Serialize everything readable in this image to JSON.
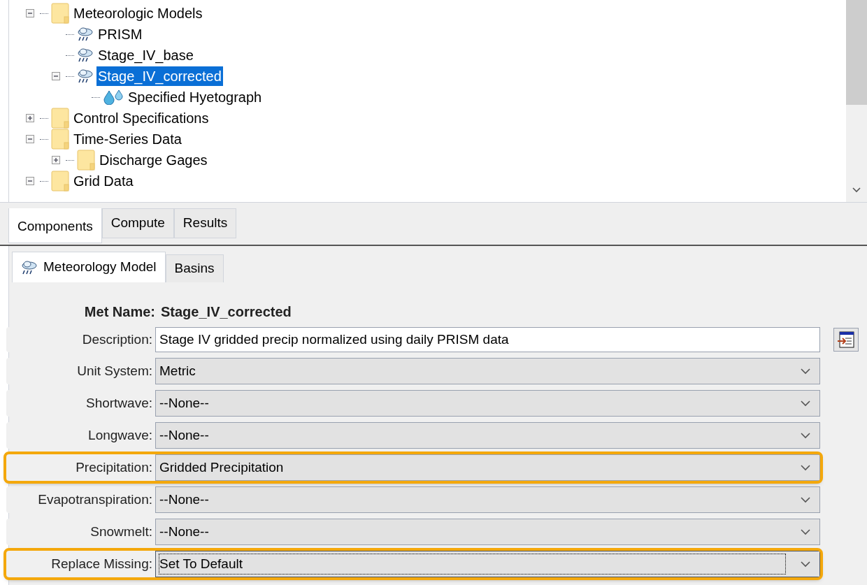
{
  "tree": [
    {
      "label": "Meteorologic Models",
      "kind": "folder",
      "expanded": true,
      "selected": false,
      "children": [
        {
          "label": "PRISM",
          "kind": "met",
          "selected": false
        },
        {
          "label": "Stage_IV_base",
          "kind": "met",
          "selected": false
        },
        {
          "label": "Stage_IV_corrected",
          "kind": "met",
          "expanded": true,
          "selected": true,
          "children": [
            {
              "label": "Specified Hyetograph",
              "kind": "gage",
              "selected": false
            }
          ]
        }
      ]
    },
    {
      "label": "Control Specifications",
      "kind": "folder",
      "expanded": false,
      "selected": false
    },
    {
      "label": "Time-Series Data",
      "kind": "folder",
      "expanded": true,
      "selected": false,
      "children": [
        {
          "label": "Discharge Gages",
          "kind": "folder",
          "expanded": false,
          "selected": false
        }
      ]
    },
    {
      "label": "Grid Data",
      "kind": "folder",
      "expanded": true,
      "selected": false
    }
  ],
  "explorer_tabs": [
    {
      "label": "Components",
      "selected": true
    },
    {
      "label": "Compute",
      "selected": false
    },
    {
      "label": "Results",
      "selected": false
    }
  ],
  "editor_tabs": [
    {
      "label": "Meteorology Model",
      "selected": true,
      "kind": "met"
    },
    {
      "label": "Basins",
      "selected": false,
      "kind": "plain"
    }
  ],
  "met_name": {
    "label": "Met Name:",
    "value": "Stage_IV_corrected"
  },
  "fields": [
    {
      "label": "Description:",
      "kind": "text",
      "value": "Stage IV gridded precip normalized using daily PRISM data",
      "highlighted": false,
      "focused": false
    },
    {
      "label": "Unit System:",
      "kind": "dropdown",
      "value": "Metric",
      "highlighted": false,
      "focused": false
    },
    {
      "label": "Shortwave:",
      "kind": "dropdown",
      "value": "--None--",
      "highlighted": false,
      "focused": false
    },
    {
      "label": "Longwave:",
      "kind": "dropdown",
      "value": "--None--",
      "highlighted": false,
      "focused": false
    },
    {
      "label": "Precipitation:",
      "kind": "dropdown",
      "value": "Gridded Precipitation",
      "highlighted": true,
      "focused": false
    },
    {
      "label": "Evapotranspiration:",
      "kind": "dropdown",
      "value": "--None--",
      "highlighted": false,
      "focused": false
    },
    {
      "label": "Snowmelt:",
      "kind": "dropdown",
      "value": "--None--",
      "highlighted": false,
      "focused": false
    },
    {
      "label": "Replace Missing:",
      "kind": "dropdown",
      "value": "Set To Default",
      "highlighted": true,
      "focused": true
    }
  ]
}
